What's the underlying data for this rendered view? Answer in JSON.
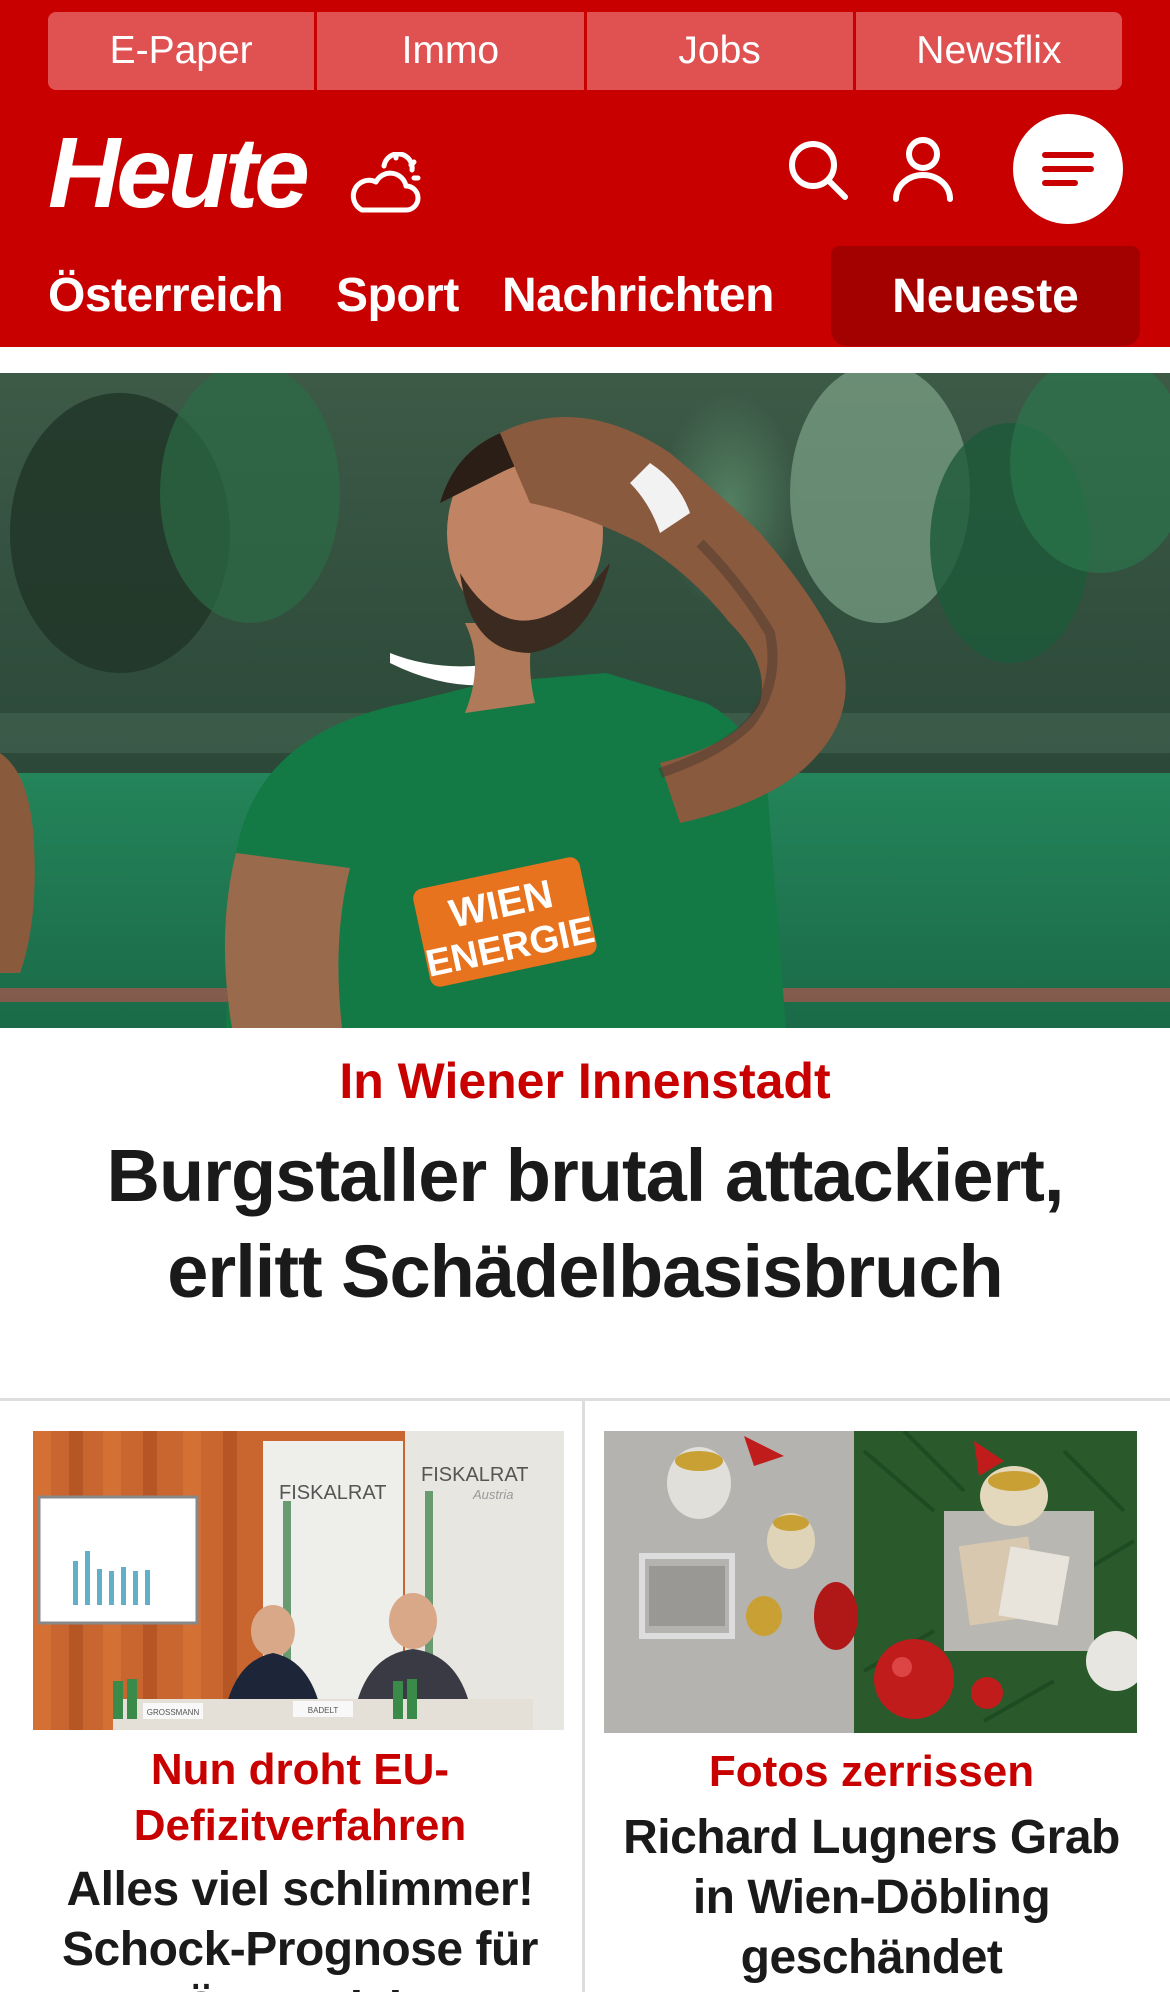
{
  "topnav": {
    "items": [
      "E-Paper",
      "Immo",
      "Jobs",
      "Newsflix"
    ]
  },
  "header": {
    "logo": "Heute",
    "weather_icon": "cloud-sun-icon",
    "search_icon": "search-icon",
    "user_icon": "user-icon",
    "menu_icon": "menu-icon"
  },
  "categories": {
    "items": [
      "Österreich",
      "Sport",
      "Nachrichten"
    ],
    "active": "Neueste"
  },
  "hero": {
    "kicker": "In Wiener Innenstadt",
    "title": "Burgstaller brutal attackiert, erlitt Schädelbasisbruch",
    "jersey_text_1": "WIEN",
    "jersey_text_2": "ENERGIE"
  },
  "teasers": [
    {
      "kicker": "Nun droht EU-Defizitverfahren",
      "title": "Alles viel schlimmer! Schock-Prognose für Österreich",
      "sign_1": "FISKALRAT",
      "sign_2": "FISKALRAT",
      "sign_sub": "Austria",
      "nameplate_1": "GROSSMANN",
      "nameplate_2": "BADELT"
    },
    {
      "kicker": "Fotos zerrissen",
      "title": "Richard Lugners Grab in Wien-Döbling geschändet"
    }
  ],
  "colors": {
    "brand_red": "#c80000",
    "topnav_bg": "#e05252",
    "active_tab": "#a30000"
  }
}
